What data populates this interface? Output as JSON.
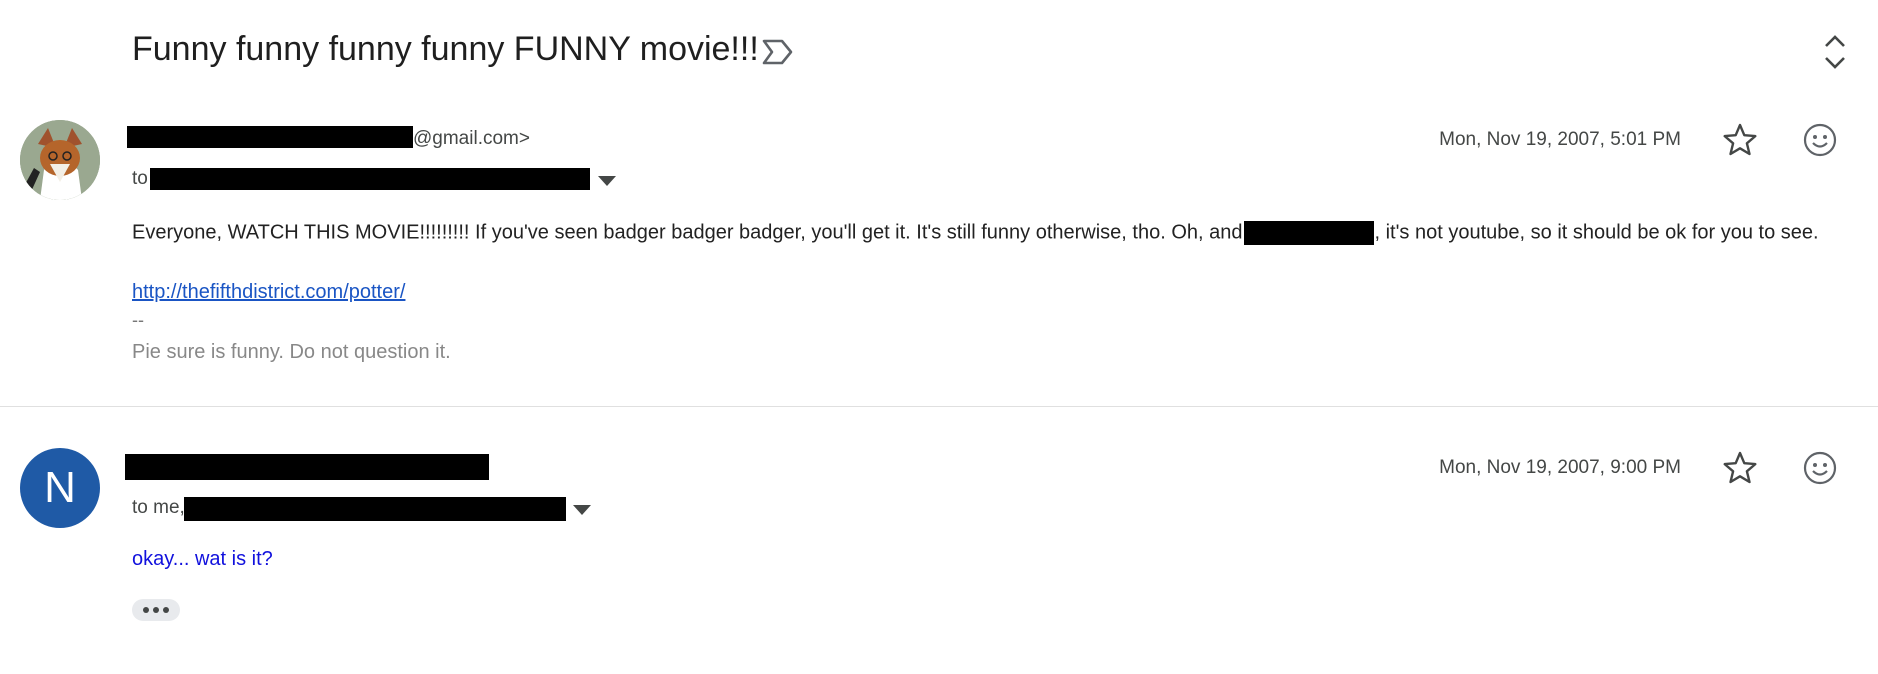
{
  "thread": {
    "subject": "Funny funny funny funny FUNNY movie!!!"
  },
  "messages": [
    {
      "sender_suffix": "@gmail.com>",
      "to_prefix": "to",
      "date": "Mon, Nov 19, 2007, 5:01 PM",
      "body_part1": "Everyone, WATCH THIS MOVIE!!!!!!!!! If you've seen badger badger badger, you'll get it. It's still funny otherwise, tho. Oh, and",
      "body_part2": ", it's not youtube, so it should be ok for you to see.",
      "link": "http://thefifthdistrict.com/potter/",
      "sig_separator": "--",
      "signature": "Pie sure is funny. Do not question it."
    },
    {
      "avatar_letter": "N",
      "to_prefix": "to me,",
      "date": "Mon, Nov 19, 2007, 9:00 PM",
      "body": "okay... wat is it?"
    }
  ],
  "icons": {
    "label": "label-outline-icon",
    "expand": "unfold-icon",
    "star": "star-outline-icon",
    "emoji": "add-reaction-icon",
    "more": "ellipsis-icon"
  },
  "colors": {
    "avatar_n": "#1f5aa6",
    "link": "#1a55c4",
    "reply": "#1111dd"
  }
}
